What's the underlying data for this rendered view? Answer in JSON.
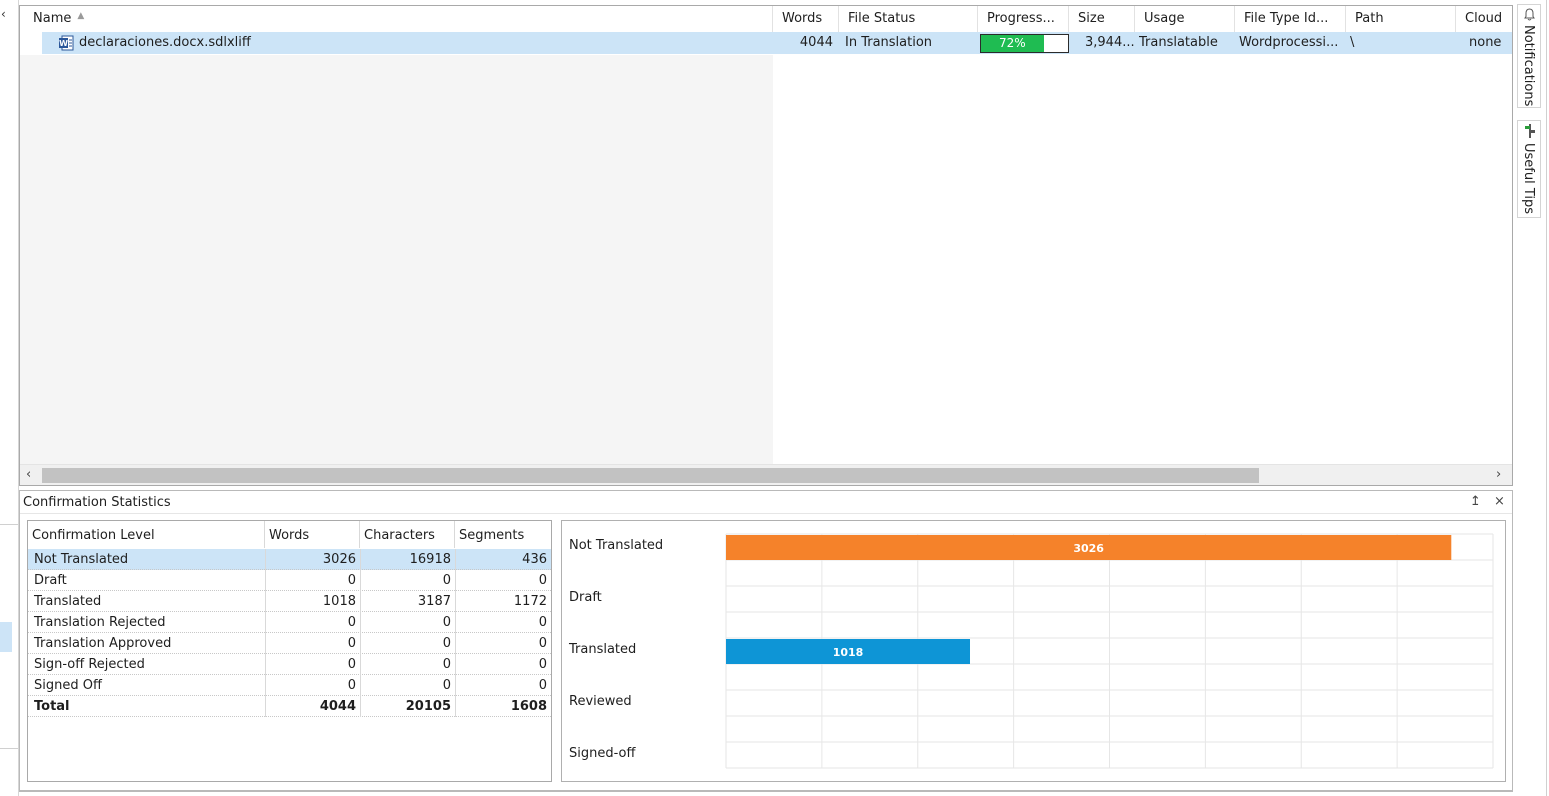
{
  "file_grid": {
    "columns": [
      {
        "label": "Name"
      },
      {
        "label": "Words"
      },
      {
        "label": "File Status"
      },
      {
        "label": "Progress..."
      },
      {
        "label": "Size"
      },
      {
        "label": "Usage"
      },
      {
        "label": "File Type Id..."
      },
      {
        "label": "Path"
      },
      {
        "label": "Cloud"
      }
    ],
    "rows": [
      {
        "name": "declaraciones.docx.sdlxliff",
        "words": "4044",
        "file_status": "In Translation",
        "progress_label": "72%",
        "progress_fraction": 0.72,
        "size": "3,944...",
        "usage": "Translatable",
        "file_type": "Wordprocessi...",
        "path": "\\",
        "cloud": "none",
        "icon": "word-document-icon"
      }
    ]
  },
  "right_tabs": {
    "notifications": "Notifications",
    "useful_tips": "Useful Tips"
  },
  "stats_panel": {
    "title": "Confirmation Statistics",
    "pin_icon": "↥",
    "close_icon": "×",
    "table": {
      "headers": [
        "Confirmation Level",
        "Words",
        "Characters",
        "Segments"
      ],
      "rows": [
        {
          "level": "Not Translated",
          "words": "3026",
          "characters": "16918",
          "segments": "436"
        },
        {
          "level": "Draft",
          "words": "0",
          "characters": "0",
          "segments": "0"
        },
        {
          "level": "Translated",
          "words": "1018",
          "characters": "3187",
          "segments": "1172"
        },
        {
          "level": "Translation Rejected",
          "words": "0",
          "characters": "0",
          "segments": "0"
        },
        {
          "level": "Translation Approved",
          "words": "0",
          "characters": "0",
          "segments": "0"
        },
        {
          "level": "Sign-off Rejected",
          "words": "0",
          "characters": "0",
          "segments": "0"
        },
        {
          "level": "Signed Off",
          "words": "0",
          "characters": "0",
          "segments": "0"
        }
      ],
      "total": {
        "level": "Total",
        "words": "4044",
        "characters": "20105",
        "segments": "1608"
      }
    }
  },
  "chart_data": {
    "type": "bar",
    "orientation": "horizontal",
    "categories": [
      "Not Translated",
      "Draft",
      "Translated",
      "Reviewed",
      "Signed-off"
    ],
    "values": [
      3026,
      0,
      1018,
      0,
      0
    ],
    "value_labels": [
      "3026",
      "",
      "1018",
      "",
      ""
    ],
    "colors": [
      "#f5822a",
      "",
      "#0e95d6",
      "",
      ""
    ],
    "xlim": [
      0,
      3200
    ],
    "grid": true
  }
}
